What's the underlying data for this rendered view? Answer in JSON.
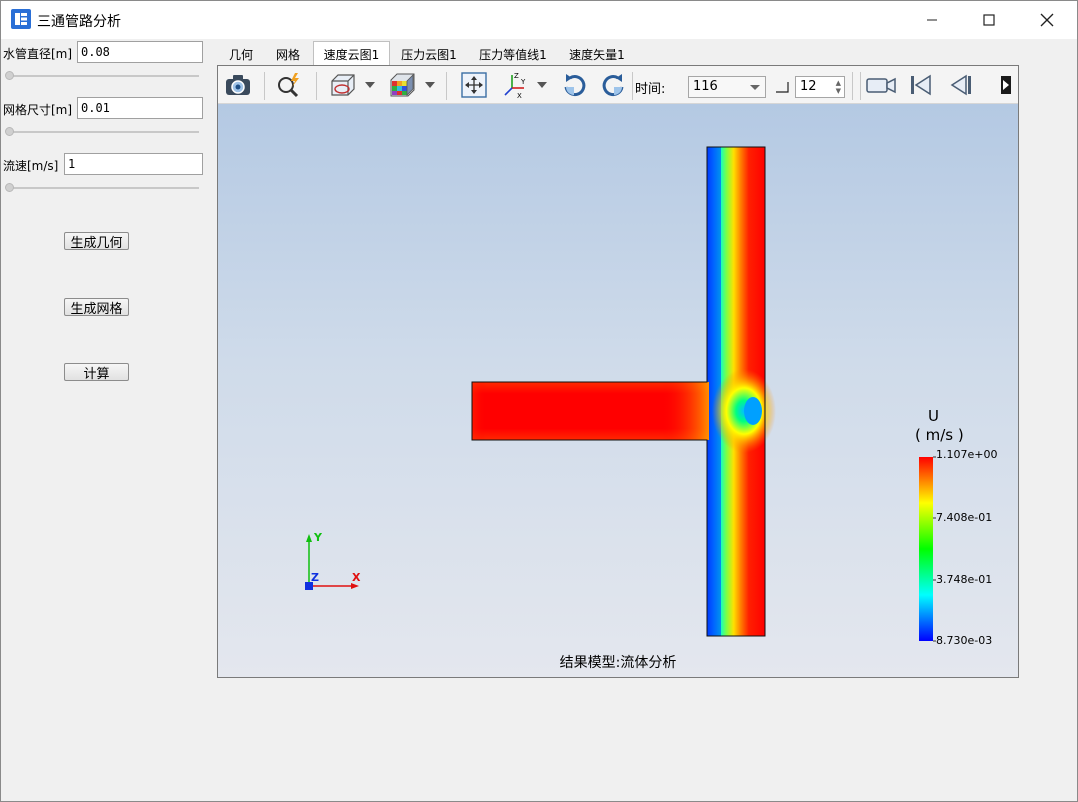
{
  "window": {
    "title": "三通管路分析"
  },
  "left_panel": {
    "fields": [
      {
        "label": "水管直径[m]",
        "value": "0.08"
      },
      {
        "label": "网格尺寸[m]",
        "value": "0.01"
      },
      {
        "label": "流速[m/s]",
        "value": "1"
      }
    ],
    "buttons": {
      "generate_geometry": "生成几何",
      "generate_mesh": "生成网格",
      "compute": "计算"
    }
  },
  "tabs": [
    {
      "label": "几何",
      "active": false
    },
    {
      "label": "网格",
      "active": false
    },
    {
      "label": "速度云图1",
      "active": true
    },
    {
      "label": "压力云图1",
      "active": false
    },
    {
      "label": "压力等值线1",
      "active": false
    },
    {
      "label": "速度矢量1",
      "active": false
    }
  ],
  "toolbar": {
    "time_label": "时间:",
    "time_value": "116",
    "step_value": "12",
    "icons": [
      "camera-icon",
      "zoom-lightning-icon",
      "view-box-icon",
      "color-cube-icon",
      "fit-view-icon",
      "axes-icon",
      "rotate-cw-icon",
      "rotate-ccw-icon",
      "record-video-icon",
      "first-frame-icon",
      "prev-frame-icon",
      "play-icon"
    ]
  },
  "viewport": {
    "caption": "结果模型:流体分析",
    "axes": {
      "x": "X",
      "y": "Y",
      "z": "Z"
    },
    "legend": {
      "title": "U",
      "unit": "( m/s )",
      "ticks": [
        "1.107e+00",
        "7.408e-01",
        "3.748e-01",
        "8.730e-03"
      ]
    }
  },
  "colors": {
    "accent_blue": "#1f5fbf",
    "high": "#ff0000",
    "mid_high": "#ffff00",
    "mid": "#00ff00",
    "mid_low": "#00ffff",
    "low": "#0000ff"
  }
}
